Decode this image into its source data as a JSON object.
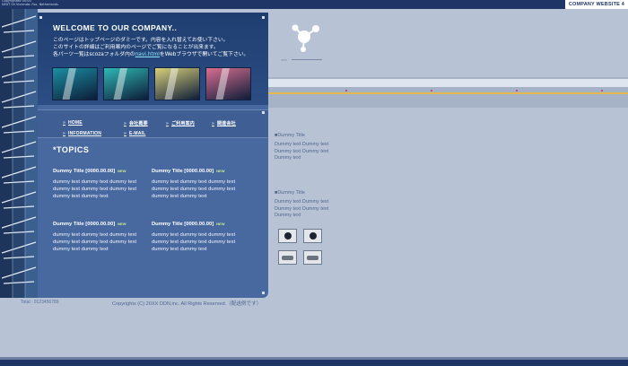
{
  "topbar": {
    "tiny_line1": "Copyrighted 00:00",
    "tiny_line2": "NEXT 00 Vivienda: Fox, Netherlands",
    "site_badge": "COMPANY WEBSITE 4"
  },
  "header": {
    "welcome": "WELCOME TO OUR COMPANY..",
    "intro_line1": "このページはトップページのダミーです。内容を入れ替えてお使い下さい。",
    "intro_line2": "このサイトの詳細はご利用案内のページでご覧になることが出来ます。",
    "intro_line3_pre": "各パーツ一覧はscozaフォルダ内の",
    "intro_link": "navi.html",
    "intro_line3_post": "をWebブラウザで開いてご覧下さい。"
  },
  "thumbnails": [
    "#1b8fa3",
    "#2fb9b4",
    "#d8d07a",
    "#d86f90"
  ],
  "nav": {
    "arrow": "»",
    "items": [
      "HOME",
      "会社概要",
      "ご利用案内",
      "関連会社",
      "INFORMATION",
      "E-MAIL"
    ]
  },
  "topics": {
    "title": "*TOPICS",
    "new_badge": "NEW",
    "items": [
      {
        "title": "Dummy Title [0000.00.00]",
        "body": "dummy text dummy text dummy text dummy text dummy text dummy text dummy text dummy text"
      },
      {
        "title": "Dummy Title [0000.00.00]",
        "body": "dummy text dummy text dummy text dummy text dummy text dummy text dummy text dummy text"
      },
      {
        "title": "Dummy Title [0000.00.00]",
        "body": "dummy text dummy text dummy text dummy text dummy text dummy text dummy text dummy text"
      },
      {
        "title": "Dummy Title [0000.00.00]",
        "body": "dummy text dummy text dummy text dummy text dummy text dummy text dummy text dummy text"
      }
    ]
  },
  "footer": {
    "total": "Total : 0123456789",
    "copyright": "Copyrights (C) 20XX DDN,inc. All Rights Reserved.（配送例です）"
  },
  "side": {
    "logo_label": "xxxx",
    "box1": {
      "heading": "■Dummy Title",
      "text": "Dummy text Dummy text Dummy text Dummy text Dummy text"
    },
    "box2": {
      "heading": "■Dummy Title",
      "text": "Dummy text Dummy text Dummy text Dummy text Dummy text"
    }
  },
  "colors": {
    "brand_dark": "#1e3566",
    "panel": "#4868a0",
    "page_bg": "#b7c3d5",
    "new_badge": "#c8f08a",
    "link": "#8ee6ff"
  }
}
